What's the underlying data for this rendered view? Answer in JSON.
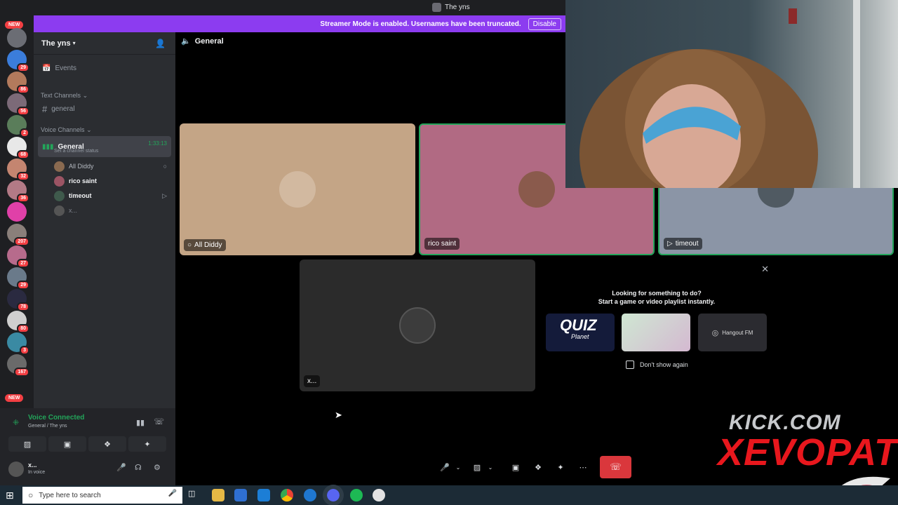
{
  "window": {
    "title": "The yns"
  },
  "banner": {
    "message": "Streamer Mode is enabled. Usernames have been truncated.",
    "button": "Disable"
  },
  "rail": {
    "new_top": "NEW",
    "new_bottom": "NEW",
    "servers": [
      {
        "badge": ""
      },
      {
        "badge": "29"
      },
      {
        "badge": "86"
      },
      {
        "badge": "56"
      },
      {
        "badge": "2"
      },
      {
        "badge": "68"
      },
      {
        "badge": "32"
      },
      {
        "badge": "36"
      },
      {
        "badge": ""
      },
      {
        "badge": "207"
      },
      {
        "badge": "27"
      },
      {
        "badge": "29"
      },
      {
        "badge": "78"
      },
      {
        "badge": "80"
      },
      {
        "badge": "3"
      },
      {
        "badge": "167"
      }
    ]
  },
  "server": {
    "name": "The yns"
  },
  "sidebar": {
    "events": "Events",
    "text_category": "Text Channels",
    "text_channel": "general",
    "voice_category": "Voice Channels",
    "voice_channel": {
      "name": "General",
      "timer": "1:33:13",
      "status": "Set a channel status"
    },
    "members": [
      {
        "name": "All Diddy"
      },
      {
        "name": "rico saint"
      },
      {
        "name": "timeout"
      },
      {
        "name": "x..."
      }
    ]
  },
  "voice_panel": {
    "status": "Voice Connected",
    "location": "General / The yns"
  },
  "user": {
    "name": "x...",
    "status": "In voice"
  },
  "call": {
    "channel": "General",
    "tiles": [
      {
        "label": "All Diddy"
      },
      {
        "label": "rico saint"
      },
      {
        "label": "timeout"
      },
      {
        "label": "x..."
      }
    ]
  },
  "activity": {
    "line1": "Looking for something to do?",
    "line2": "Start a game or video playlist instantly.",
    "quiz_title": "QUIZ",
    "quiz_sub": "Planet",
    "hangout": "Hangout FM",
    "dont_show": "Don't show again"
  },
  "overlay": {
    "line1": "KICK.COM",
    "line2": "XEVOPAT"
  },
  "taskbar": {
    "search_placeholder": "Type here to search"
  }
}
